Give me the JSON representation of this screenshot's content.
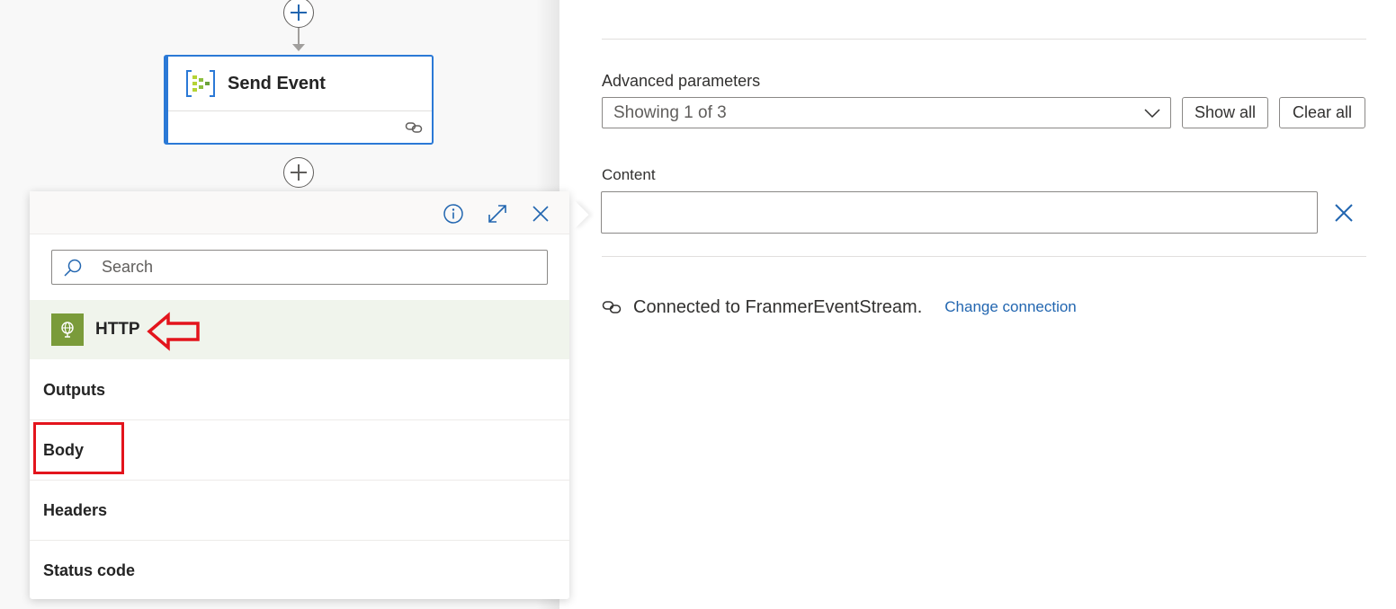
{
  "canvas": {
    "action_card": {
      "title": "Send Event",
      "icon": "event-hubs-icon",
      "footer_icon": "link-icon"
    },
    "add_buttons": [
      "add-step-top",
      "add-step-bottom"
    ]
  },
  "picker": {
    "header_icons": [
      "info-icon",
      "expand-icon",
      "close-icon"
    ],
    "search": {
      "placeholder": "Search",
      "value": ""
    },
    "group": {
      "label": "HTTP",
      "icon": "globe-icon"
    },
    "tokens": [
      "Outputs",
      "Body",
      "Headers",
      "Status code"
    ],
    "annotation_color": "#e3141c"
  },
  "panel": {
    "advanced_label": "Advanced parameters",
    "advanced_value": "Showing 1 of 3",
    "show_all": "Show all",
    "clear_all": "Clear all",
    "content_label": "Content",
    "content_value": "",
    "connection_text": "Connected to FranmerEventStream.",
    "change_connection": "Change connection",
    "link_color": "#2266b0",
    "accent_color": "#2b79d6"
  }
}
